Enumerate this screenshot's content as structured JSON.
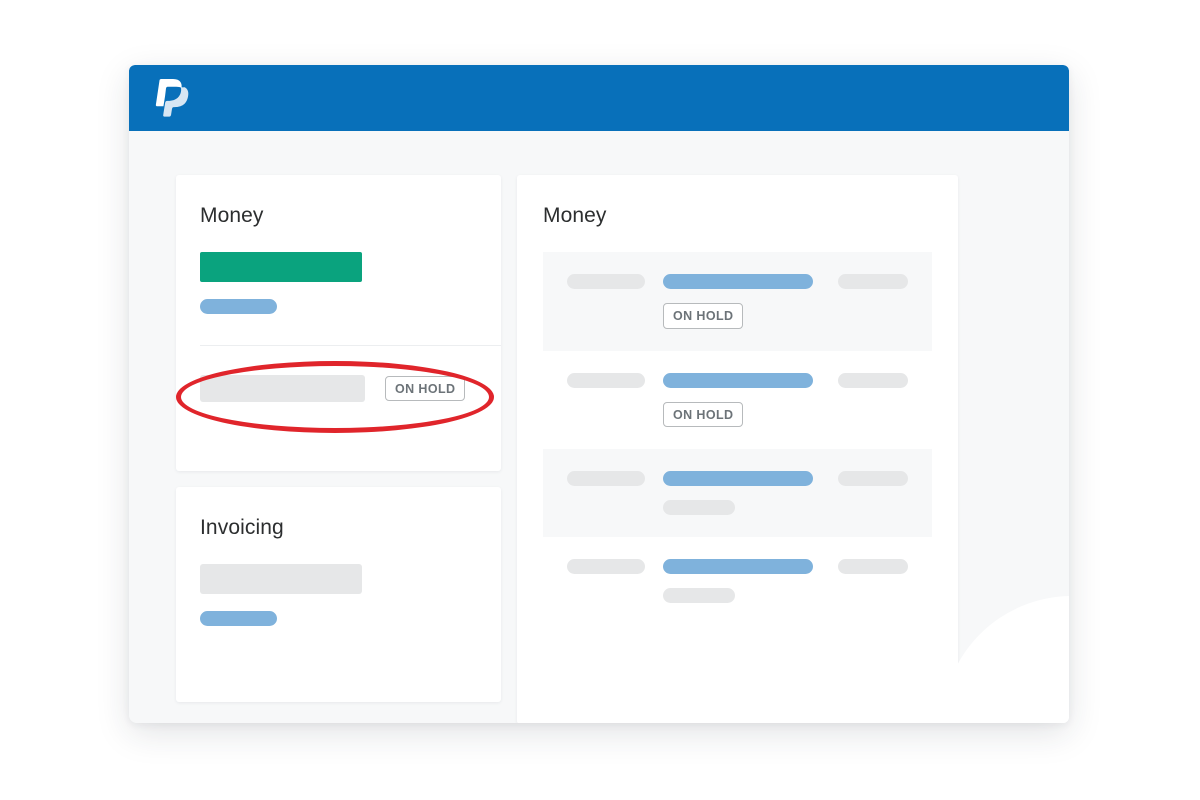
{
  "window": {
    "brand_logo": "paypal-logo-icon",
    "header_color": "#0870ba"
  },
  "left_column": {
    "money_card": {
      "title": "Money",
      "primary_bar_color": "#0aa37e",
      "secondary_pill_color": "#7fb2dc",
      "hold_row": {
        "placeholder_label": "",
        "badge_label": "ON HOLD"
      }
    },
    "invoicing_card": {
      "title": "Invoicing",
      "placeholder_block_color": "#e6e7e8",
      "pill_color": "#7fb2dc"
    }
  },
  "right_column": {
    "money_panel": {
      "title": "Money",
      "rows": [
        {
          "shaded": true,
          "badge_label": "ON HOLD",
          "has_badge": true,
          "has_sub_pill": false
        },
        {
          "shaded": false,
          "badge_label": "ON HOLD",
          "has_badge": true,
          "has_sub_pill": false
        },
        {
          "shaded": true,
          "badge_label": "",
          "has_badge": false,
          "has_sub_pill": true
        },
        {
          "shaded": false,
          "badge_label": "",
          "has_badge": false,
          "has_sub_pill": true
        }
      ]
    }
  },
  "annotation": {
    "type": "ellipse-highlight",
    "color": "#e0252b",
    "target": "on-hold-row-left-money-card"
  }
}
